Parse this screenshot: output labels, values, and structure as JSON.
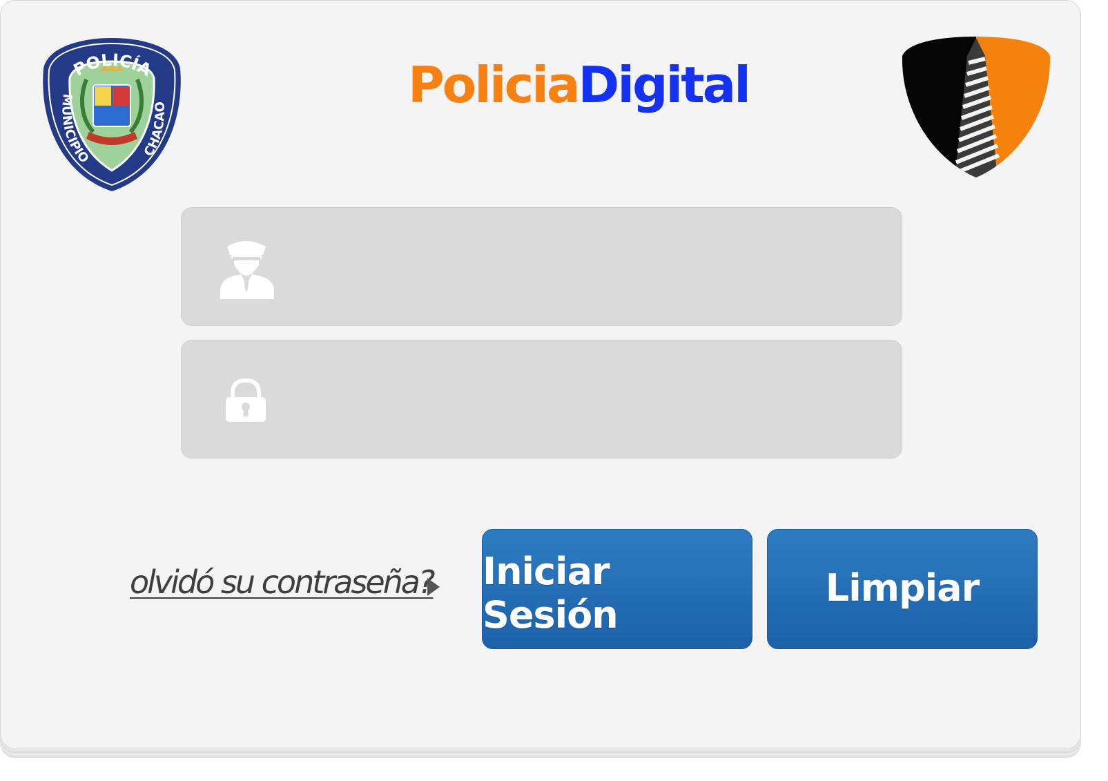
{
  "header": {
    "title_part1": "Policia",
    "title_part2": "Digital"
  },
  "logo_left": {
    "top_text": "POLICÍA",
    "left_text": "MUNICIPIO",
    "right_text": "CHACAO",
    "icon": "police-badge-logo",
    "colors": {
      "ring": "#233a86",
      "shield": "#9fd29a"
    }
  },
  "logo_right": {
    "icon": "building-shield-logo",
    "colors": {
      "left": "#050505",
      "right": "#f5820c"
    }
  },
  "form": {
    "username": {
      "icon": "police-officer-icon",
      "value": "",
      "placeholder": ""
    },
    "password": {
      "icon": "padlock-icon",
      "value": "",
      "placeholder": ""
    }
  },
  "forgot_link": "olvidó su contraseña?",
  "buttons": {
    "login": "Iniciar Sesión",
    "clear": "Limpiar"
  },
  "colors": {
    "background": "#f4f4f4",
    "field_bg": "#dadada",
    "button": "#2069b1",
    "brand_orange": "#f68011",
    "brand_blue": "#1432f0"
  }
}
